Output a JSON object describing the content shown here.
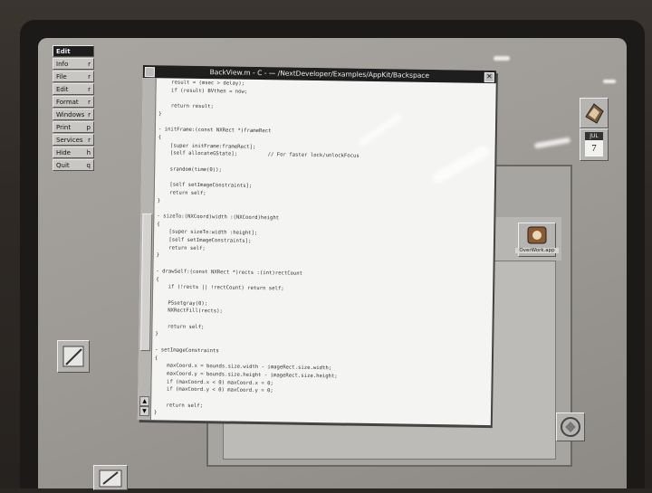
{
  "menu": {
    "title": "Edit",
    "items": [
      {
        "label": "Info",
        "key": "r"
      },
      {
        "label": "File",
        "key": "r"
      },
      {
        "label": "Edit",
        "key": "r"
      },
      {
        "label": "Format",
        "key": "r"
      },
      {
        "label": "Windows",
        "key": "r"
      },
      {
        "label": "Print",
        "key": "p"
      },
      {
        "label": "Services",
        "key": "r"
      },
      {
        "label": "Hide",
        "key": "h"
      },
      {
        "label": "Quit",
        "key": "q"
      }
    ]
  },
  "window": {
    "title": "BackView.m - C - — /NextDeveloper/Examples/AppKit/Backspace",
    "close_glyph": "✕"
  },
  "code_lines": [
    "    result = (msec > delay);",
    "    if (result) BVthen = now;",
    "",
    "    return result;",
    "}",
    "",
    "- initFrame:(const NXRect *)frameRect",
    "{",
    "    [super initFrame:frameRect];",
    "    [self allocateGState];          // For faster lock/unlockFocus",
    "",
    "    srandom(time(0));",
    "",
    "    [self setImageConstraints];",
    "    return self;",
    "}",
    "",
    "- sizeTo:(NXCoord)width :(NXCoord)height",
    "{",
    "    [super sizeTo:width :height];",
    "    [self setImageConstraints];",
    "    return self;",
    "}",
    "",
    "- drawSelf:(const NXRect *)rects :(int)rectCount",
    "{",
    "    if (!rects || !rectCount) return self;",
    "",
    "    PSsetgray(0);",
    "    NXRectFill(rects);",
    "",
    "    return self;",
    "}",
    "",
    "- setImageConstraints",
    "{",
    "    maxCoord.x = bounds.size.width - imageRect.size.width;",
    "    maxCoord.y = bounds.size.height - imageRect.size.height;",
    "    if (maxCoord.x < 0) maxCoord.x = 0;",
    "    if (maxCoord.y < 0) maxCoord.y = 0;",
    "",
    "    return self;",
    "}"
  ],
  "dock": {
    "date_month": "JUL",
    "date_day": "7",
    "overview_label": "OverWork.app"
  },
  "colors": {
    "screen": "#a09d98",
    "titlebar": "#1e1e1e",
    "document": "#f4f4f2"
  },
  "icons": [
    "workspace-icon",
    "calendar-icon",
    "overwork-app-icon",
    "drawing-tool-icon",
    "recycler-icon",
    "pen-tool-icon"
  ]
}
